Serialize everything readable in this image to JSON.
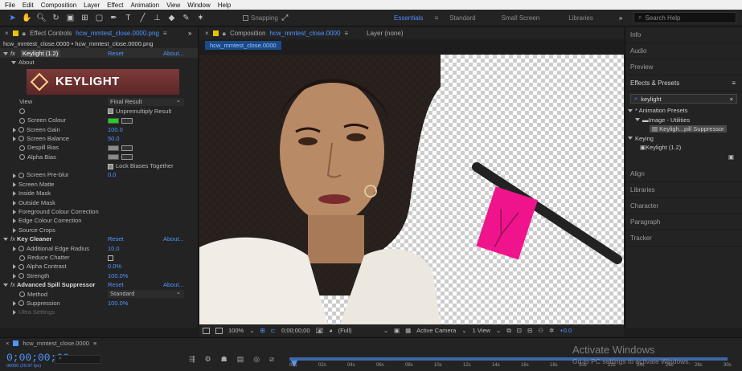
{
  "menu": [
    "File",
    "Edit",
    "Composition",
    "Layer",
    "Effect",
    "Animation",
    "View",
    "Window",
    "Help"
  ],
  "toolbar": {
    "snapping_label": "Snapping",
    "workspaces": [
      "Essentials",
      "Standard",
      "Small Screen",
      "Libraries"
    ],
    "active_workspace": "Essentials",
    "overflow": "»",
    "search_placeholder": "Search Help"
  },
  "effect_controls": {
    "tab_title": "Effect Controls",
    "tab_file": "hcw_mmtest_close.0000.png",
    "overflow": "»",
    "breadcrumb": "hcw_mmtest_close.0000 • hcw_mmtest_close.0000.png",
    "keylight": {
      "name": "Keylight (1.2)",
      "reset": "Reset",
      "about": "About...",
      "about_section": "About",
      "logo_text": "KEYLIGHT",
      "view_label": "View",
      "view_value": "Final Result",
      "unpremultiply": "Unpremultiply Result",
      "screen_colour": "Screen Colour",
      "screen_colour_value": "#1fd01f",
      "screen_gain": "Screen Gain",
      "screen_gain_value": "100.0",
      "screen_balance": "Screen Balance",
      "screen_balance_value": "50.0",
      "despill_bias": "Despill Bias",
      "alpha_bias": "Alpha Bias",
      "bias_swatch_color": "#8b8b8b",
      "lock_biases": "Lock Biases Together",
      "screen_preblur": "Screen Pre-blur",
      "screen_preblur_value": "0.0",
      "sections": [
        "Screen Matte",
        "Inside Mask",
        "Outside Mask",
        "Foreground Colour Correction",
        "Edge Colour Correction",
        "Source Crops"
      ]
    },
    "key_cleaner": {
      "name": "Key Cleaner",
      "reset": "Reset",
      "about": "About...",
      "additional_edge_radius": "Additional Edge Radius",
      "additional_edge_radius_value": "10.0",
      "reduce_chatter": "Reduce Chatter",
      "alpha_contrast": "Alpha Contrast",
      "alpha_contrast_value": "0.0%",
      "strength": "Strength",
      "strength_value": "100.0%"
    },
    "spill_suppressor": {
      "name": "Advanced Spill Suppressor",
      "reset": "Reset",
      "about": "About...",
      "method": "Method",
      "method_value": "Standard",
      "suppression": "Suppression",
      "suppression_value": "100.0%",
      "ultra_settings": "Ultra Settings"
    }
  },
  "composition": {
    "tab_title": "Composition",
    "tab_file": "hcw_mmtest_close.0000",
    "layer_tab": "Layer (none)",
    "subtab": "hcw_mmtest_close.0000",
    "footer": {
      "zoom": "100%",
      "timecode": "0;00;00;00",
      "resolution": "(Full)",
      "camera": "Active Camera",
      "view": "1 View",
      "exposure": "+0.0"
    }
  },
  "right_panel": {
    "items": [
      "Info",
      "Audio",
      "Preview",
      "Effects & Presets"
    ],
    "search_value": "keylight",
    "tree": {
      "animation_presets": "* Animation Presets",
      "image_utilities": "Image - Utilities",
      "preset_item": "Keyligh...pill Suppressor",
      "keying": "Keying",
      "keylight_effect": "Keylight (1.2)"
    },
    "bottom_items": [
      "Align",
      "Libraries",
      "Character",
      "Paragraph",
      "Tracker"
    ]
  },
  "timeline": {
    "tab_title": "hcw_mmtest_close.0000",
    "current_time": "0;00;00;00",
    "fps_note": "00000 (29.97 fps)",
    "search_placeholder": "",
    "ruler_labels": [
      "00s",
      "02s",
      "04s",
      "06s",
      "08s",
      "10s",
      "12s",
      "14s",
      "16s",
      "18s",
      "20s",
      "22s",
      "24s",
      "26s",
      "28s",
      "30s"
    ]
  },
  "watermark": {
    "line1": "Activate Windows",
    "line2": "Go to PC settings to activate Windows."
  },
  "colors": {
    "accent": "#4f96ff",
    "sticky_note": "#f0148c"
  }
}
